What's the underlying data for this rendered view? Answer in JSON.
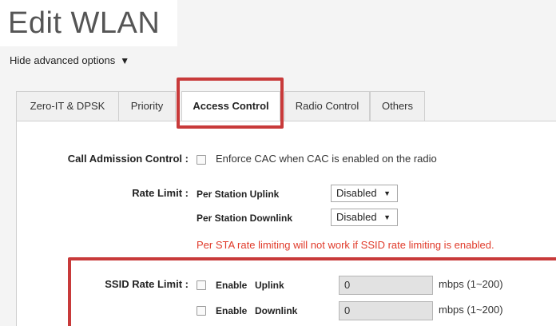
{
  "page": {
    "title": "Edit WLAN"
  },
  "advanced": {
    "label": "Hide advanced options",
    "caret": "▼"
  },
  "tabs": [
    {
      "label": "Zero-IT & DPSK"
    },
    {
      "label": "Priority"
    },
    {
      "label": "Access Control",
      "active": true
    },
    {
      "label": "Radio Control"
    },
    {
      "label": "Others"
    }
  ],
  "access_control": {
    "cac": {
      "label": "Call Admission Control :",
      "checkbox_label": "Enforce CAC when CAC is enabled on the radio",
      "checked": false
    },
    "rate_limit": {
      "label": "Rate Limit :",
      "uplink_label": "Per Station Uplink",
      "uplink_value": "Disabled",
      "downlink_label": "Per Station Downlink",
      "downlink_value": "Disabled",
      "warning": "Per STA rate limiting will not work if SSID rate limiting is enabled."
    },
    "ssid_rate_limit": {
      "label": "SSID Rate Limit :",
      "rows": [
        {
          "enable_label": "Enable",
          "direction": "Uplink",
          "value": "0",
          "unit": "mbps (1~200)",
          "checked": false
        },
        {
          "enable_label": "Enable",
          "direction": "Downlink",
          "value": "0",
          "unit": "mbps (1~200)",
          "checked": false
        }
      ]
    }
  },
  "highlight_color": "#c83a3a",
  "warning_color": "#e03a2a"
}
